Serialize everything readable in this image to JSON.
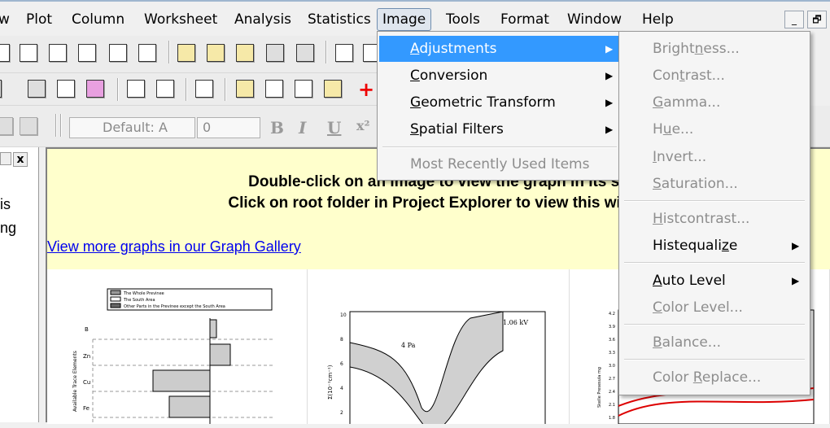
{
  "menubar": {
    "items": [
      "w",
      "Plot",
      "Column",
      "Worksheet",
      "Analysis",
      "Statistics",
      "Image",
      "Tools",
      "Format",
      "Window",
      "Help"
    ],
    "active": "Image",
    "minimize_symbol": "_",
    "restore_symbol": "🗗"
  },
  "toolbar": {
    "font_combo": "Default: A",
    "size_combo": "0",
    "bold": "B",
    "italic": "I",
    "underline": "U",
    "superscript": "x²"
  },
  "left_panel": {
    "close_symbol": "x",
    "line1": "is",
    "line2": "ng"
  },
  "banner": {
    "line1": "Double-click on an image to view the graph in its su",
    "line2": "Click on root folder in Project Explorer to view this windo",
    "link": "View more graphs in our Graph Gallery"
  },
  "thumbnails": {
    "bar": {
      "legend": [
        "The Whole Previnee",
        "The South Area",
        "Other Parts in the Previnee except the South Area"
      ],
      "categories": [
        "B",
        "Zn",
        "Cu",
        "Fe"
      ],
      "ylabel": "Available Trace Elements"
    },
    "band": {
      "annotation": "1.06 kV",
      "label": "4 Pa",
      "ylabel": "Σ(10⁻¹cm⁻¹)",
      "ticks": [
        "10",
        "8",
        "6",
        "4",
        "2"
      ]
    },
    "contour": {
      "ylabel": "Skelle Presesula mg",
      "ticks": [
        "4.2",
        "3.9",
        "3.6",
        "3.3",
        "3.0",
        "2.7",
        "2.4",
        "2.1",
        "1.8"
      ]
    }
  },
  "image_menu": {
    "items": [
      {
        "label": "Adjustments",
        "accel": "A",
        "has_sub": true,
        "highlighted": true
      },
      {
        "label": "Conversion",
        "accel": "C",
        "has_sub": true
      },
      {
        "label": "Geometric Transform",
        "accel": "G",
        "has_sub": true
      },
      {
        "label": "Spatial Filters",
        "accel": "S",
        "has_sub": true
      },
      {
        "label": "Most Recently Used Items",
        "disabled": true
      }
    ]
  },
  "adjustments_menu": {
    "items": [
      {
        "label": "Brightness...",
        "disabled": true
      },
      {
        "label": "Contrast...",
        "disabled": true
      },
      {
        "label": "Gamma...",
        "disabled": true
      },
      {
        "label": "Hue...",
        "disabled": true
      },
      {
        "label": "Invert...",
        "disabled": true
      },
      {
        "label": "Saturation...",
        "disabled": true
      },
      {
        "label": "Histcontrast...",
        "disabled": true
      },
      {
        "label": "Histequalize",
        "has_sub": true
      },
      {
        "label": "Auto Level",
        "has_sub": true
      },
      {
        "label": "Color Level...",
        "disabled": true
      },
      {
        "label": "Balance...",
        "disabled": true
      },
      {
        "label": "Color Replace...",
        "disabled": true
      }
    ]
  },
  "colors": {
    "highlight": "#3399ff",
    "banner": "#ffffcc",
    "link": "#0000ee"
  }
}
